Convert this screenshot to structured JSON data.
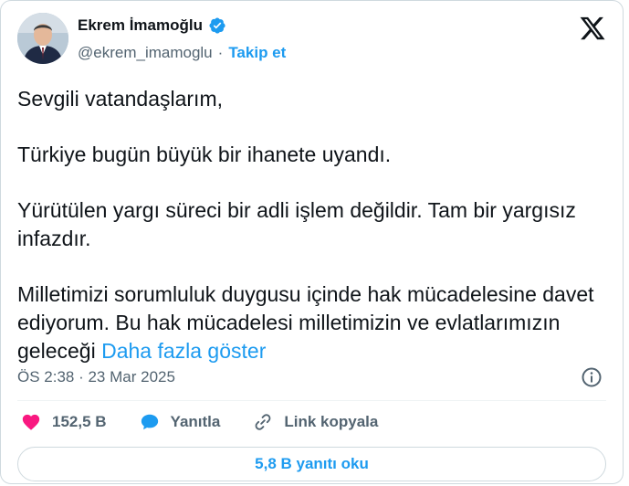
{
  "author": {
    "display_name": "Ekrem İmamoğlu",
    "handle": "@ekrem_imamoglu",
    "separator": "·",
    "follow_label": "Takip et"
  },
  "tweet": {
    "paragraphs": [
      "Sevgili vatandaşlarım,",
      "Türkiye bugün büyük bir ihanete uyandı.",
      "Yürütülen yargı süreci bir adli işlem değildir. Tam bir yargısız infazdır.",
      "Milletimizi sorumluluk duygusu içinde hak mücadelesine davet ediyorum. Bu hak mücadelesi milletimizin ve evlatlarımızın geleceği"
    ],
    "show_more_label": "Daha fazla göster",
    "timestamp": "ÖS 2:38 · 23 Mar 2025"
  },
  "actions": {
    "likes": "152,5 B",
    "reply_label": "Yanıtla",
    "copy_link_label": "Link kopyala",
    "read_replies_label": "5,8 B yanıtı oku"
  },
  "icons": {
    "verified": "verified-badge-icon",
    "x_logo": "x-logo-icon",
    "info": "info-icon",
    "heart": "heart-icon",
    "reply": "speech-bubble-icon",
    "link": "link-icon"
  },
  "colors": {
    "accent": "#1d9bf0",
    "like": "#f91880",
    "text": "#0f1419",
    "muted": "#536471",
    "border": "#cfd9de"
  }
}
